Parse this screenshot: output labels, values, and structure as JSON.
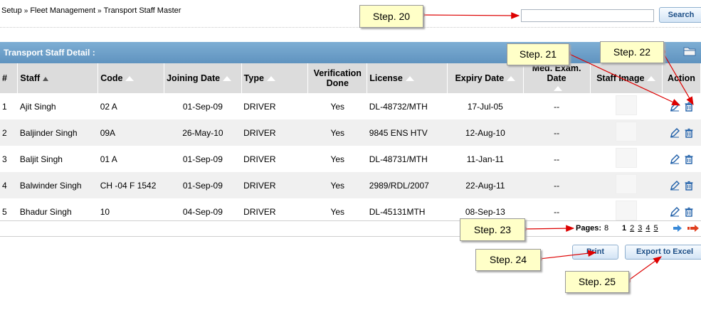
{
  "breadcrumb": {
    "items": [
      "Setup",
      "Fleet Management",
      "Transport Staff Master"
    ],
    "separator": "»"
  },
  "search": {
    "value": "",
    "button_label": "Search"
  },
  "panel": {
    "title": "Transport Staff Detail :"
  },
  "table": {
    "columns": [
      "#",
      "Staff",
      "Code",
      "Joining Date",
      "Type",
      "Verification Done",
      "License",
      "Expiry Date",
      "Med. Exam. Date",
      "Staff Image",
      "Action"
    ],
    "rows": [
      {
        "num": "1",
        "staff": "Ajit Singh",
        "code": "02 A",
        "joining": "01-Sep-09",
        "type": "DRIVER",
        "verified": "Yes",
        "license": "DL-48732/MTH",
        "expiry": "17-Jul-05",
        "med": "--"
      },
      {
        "num": "2",
        "staff": "Baljinder Singh",
        "code": "09A",
        "joining": "26-May-10",
        "type": "DRIVER",
        "verified": "Yes",
        "license": "9845 ENS HTV",
        "expiry": "12-Aug-10",
        "med": "--"
      },
      {
        "num": "3",
        "staff": "Baljit Singh",
        "code": "01 A",
        "joining": "01-Sep-09",
        "type": "DRIVER",
        "verified": "Yes",
        "license": "DL-48731/MTH",
        "expiry": "11-Jan-11",
        "med": "--"
      },
      {
        "num": "4",
        "staff": "Balwinder Singh",
        "code": "CH -04 F 1542",
        "joining": "01-Sep-09",
        "type": "DRIVER",
        "verified": "Yes",
        "license": "2989/RDL/2007",
        "expiry": "22-Aug-11",
        "med": "--"
      },
      {
        "num": "5",
        "staff": "Bhadur Singh",
        "code": "10",
        "joining": "04-Sep-09",
        "type": "DRIVER",
        "verified": "Yes",
        "license": "DL-45131MTH",
        "expiry": "08-Sep-13",
        "med": "--"
      }
    ]
  },
  "pagination": {
    "label": "Pages:",
    "total": "8",
    "pages": [
      "1",
      "2",
      "3",
      "4",
      "5"
    ],
    "current": "1"
  },
  "footer": {
    "print_label": "Print",
    "export_label": "Export to Excel"
  },
  "callouts": [
    "Step. 20",
    "Step. 21",
    "Step. 22",
    "Step. 23",
    "Step. 24",
    "Step. 25"
  ],
  "colors": {
    "header_bar": "#6a9ec9",
    "callout_bg": "#ffffc8",
    "arrow": "#dd0000",
    "icon_blue": "#1f5fa8"
  }
}
